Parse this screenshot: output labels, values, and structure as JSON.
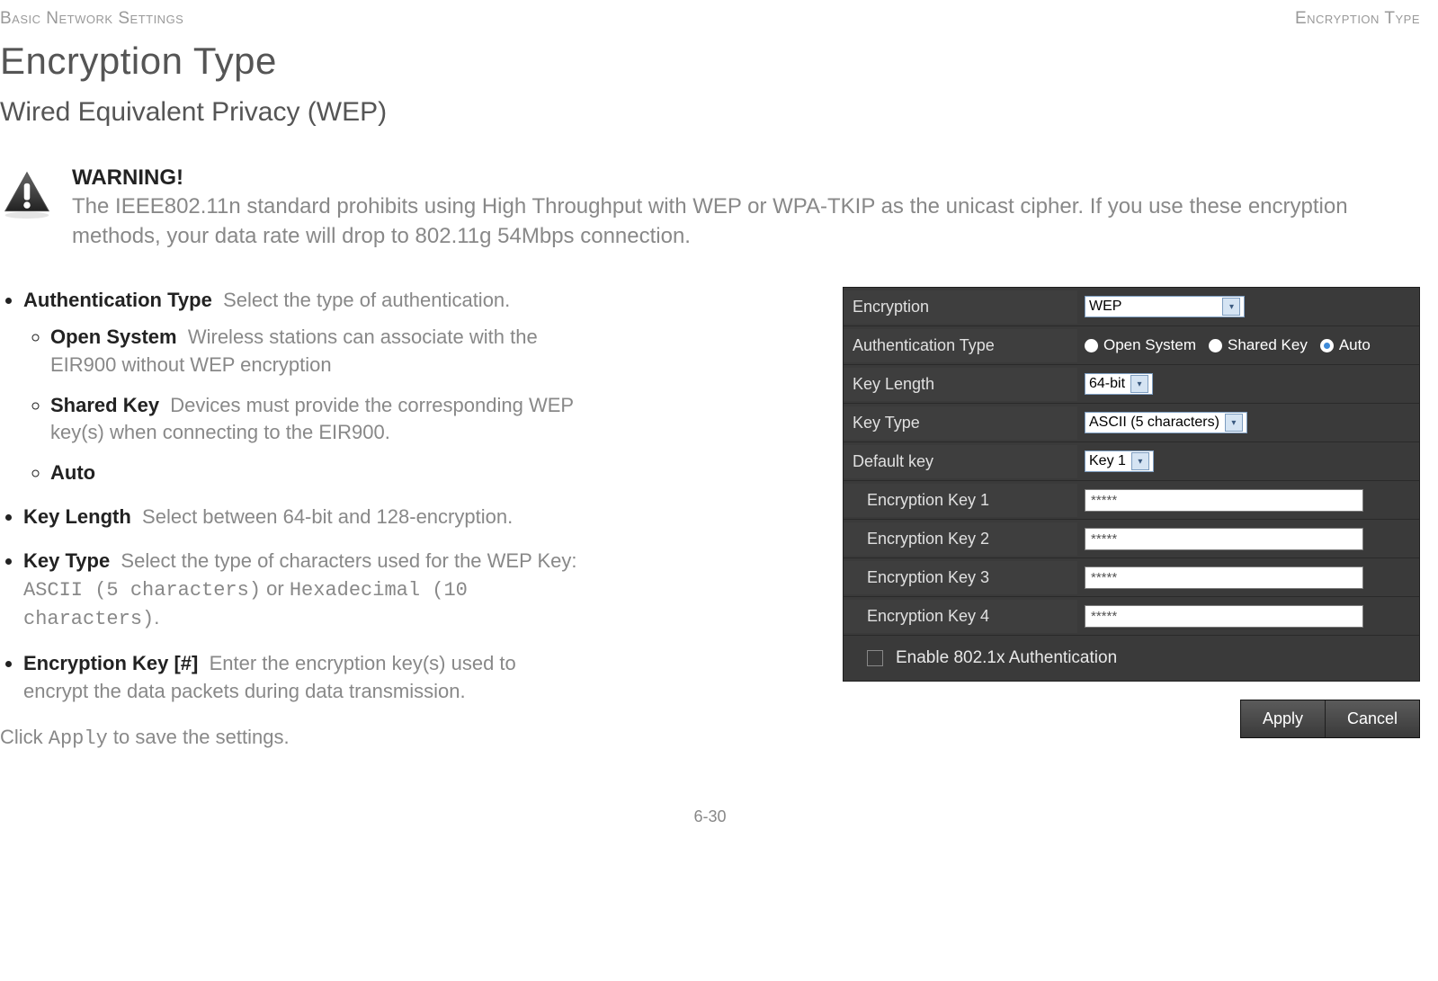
{
  "header": {
    "left": "Basic Network Settings",
    "right": "Encryption Type"
  },
  "page_title": "Encryption Type",
  "section_title": "Wired Equivalent Privacy (WEP)",
  "warning": {
    "heading": "WARNING!",
    "body": "The IEEE802.11n standard prohibits using High Throughput with WEP or WPA-TKIP as the unicast cipher. If you use these encryption methods, your data rate will drop to 802.11g 54Mbps connection."
  },
  "definitions": {
    "auth_type": {
      "term": "Authentication Type",
      "desc": "Select the type of authentication."
    },
    "open_system": {
      "term": "Open System",
      "desc": "Wireless stations can associate with the EIR900 without WEP encryption"
    },
    "shared_key": {
      "term": "Shared Key",
      "desc": "Devices must provide the corresponding WEP key(s) when connecting to the EIR900."
    },
    "auto": {
      "term": "Auto"
    },
    "key_length": {
      "term": "Key Length",
      "desc": "Select between 64-bit and 128-encryption."
    },
    "key_type": {
      "term": "Key Type",
      "desc_prefix": "Select the type of characters used for the WEP Key: ",
      "mono1": "ASCII (5 characters)",
      "mid": " or ",
      "mono2": "Hexadecimal (10 characters)",
      "suffix": "."
    },
    "enc_key": {
      "term": "Encryption Key [#]",
      "desc": "Enter the encryption key(s) used to encrypt the data packets during data transmission."
    }
  },
  "click_line": {
    "prefix": "Click ",
    "mono": "Apply",
    "suffix": " to save the settings."
  },
  "panel": {
    "rows": {
      "encryption": {
        "label": "Encryption",
        "value": "WEP"
      },
      "auth_type": {
        "label": "Authentication Type",
        "opt1": "Open System",
        "opt2": "Shared Key",
        "opt3": "Auto",
        "selected": "Auto"
      },
      "key_length": {
        "label": "Key Length",
        "value": "64-bit"
      },
      "key_type": {
        "label": "Key Type",
        "value": "ASCII (5 characters)"
      },
      "default_key": {
        "label": "Default key",
        "value": "Key 1"
      },
      "k1": {
        "label": "Encryption Key 1",
        "value": "*****"
      },
      "k2": {
        "label": "Encryption Key 2",
        "value": "*****"
      },
      "k3": {
        "label": "Encryption Key 3",
        "value": "*****"
      },
      "k4": {
        "label": "Encryption Key 4",
        "value": "*****"
      },
      "enable_8021x": "Enable 802.1x Authentication"
    },
    "buttons": {
      "apply": "Apply",
      "cancel": "Cancel"
    }
  },
  "page_number": "6-30"
}
